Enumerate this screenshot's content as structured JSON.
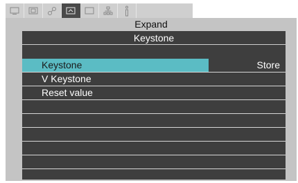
{
  "tabs": [
    {
      "icon": "picture-icon",
      "active": false
    },
    {
      "icon": "display-icon",
      "active": false
    },
    {
      "icon": "color-settings-icon",
      "active": false
    },
    {
      "icon": "expand-icon",
      "active": true
    },
    {
      "icon": "screen-icon",
      "active": false
    },
    {
      "icon": "network-icon",
      "active": false
    },
    {
      "icon": "info-icon",
      "active": false
    }
  ],
  "page_title": "Expand",
  "menu": {
    "header": "Keystone",
    "items": [
      {
        "label": "Keystone",
        "value": "Store",
        "selected": true
      },
      {
        "label": "V Keystone",
        "value": ""
      },
      {
        "label": "Reset value",
        "value": ""
      },
      {
        "label": "",
        "value": ""
      },
      {
        "label": "",
        "value": ""
      },
      {
        "label": "",
        "value": ""
      },
      {
        "label": "",
        "value": ""
      },
      {
        "label": "",
        "value": ""
      },
      {
        "label": "",
        "value": ""
      },
      {
        "label": "",
        "value": ""
      }
    ]
  },
  "colors": {
    "highlight": "#5bbcc4",
    "menu_bg": "#3e3e3e",
    "panel_bg": "#c4c4c4"
  }
}
